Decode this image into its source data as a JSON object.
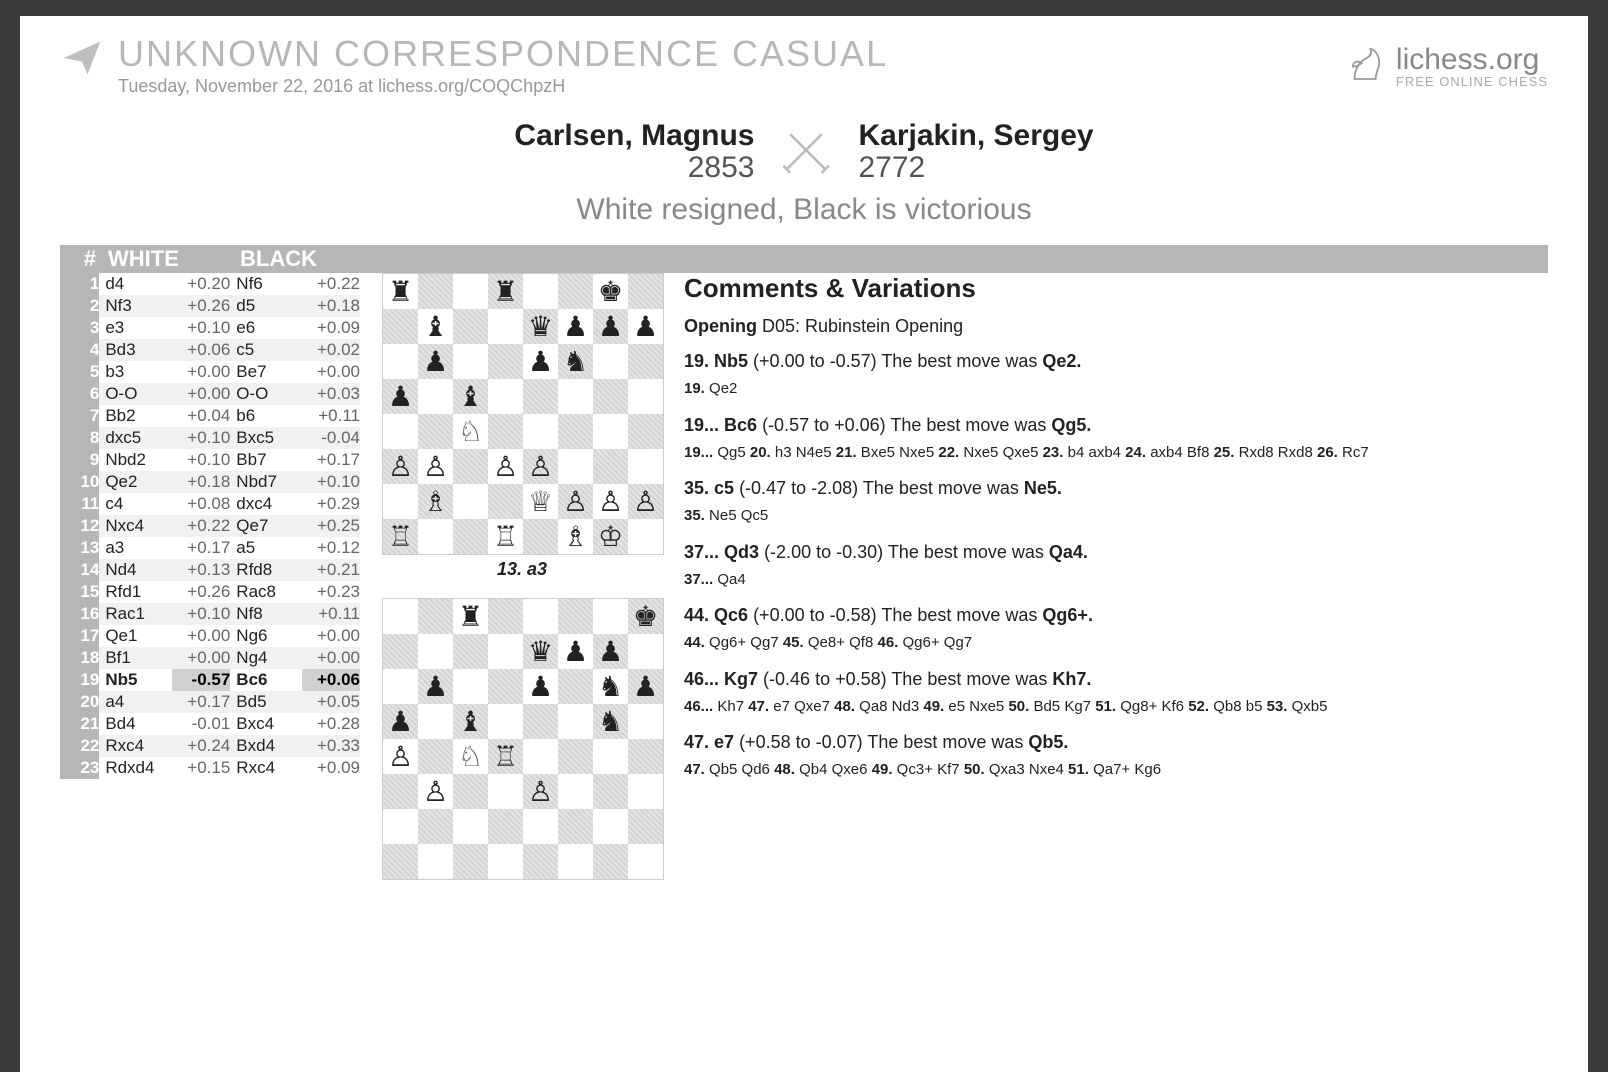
{
  "header": {
    "title": "UNKNOWN   CORRESPONDENCE   CASUAL",
    "subtitle": "Tuesday, November 22, 2016 at lichess.org/COQChpzH",
    "site_name": "lichess.org",
    "site_tag": "FREE ONLINE CHESS"
  },
  "matchup": {
    "white_name": "Carlsen, Magnus",
    "white_rating": "2853",
    "black_name": "Karjakin, Sergey",
    "black_rating": "2772",
    "result": "White resigned, Black is victorious"
  },
  "table_header": {
    "num": "#",
    "white": "WHITE",
    "black": "BLACK"
  },
  "moves": [
    {
      "n": "1",
      "w": "d4",
      "we": "+0.20",
      "b": "Nf6",
      "be": "+0.22"
    },
    {
      "n": "2",
      "w": "Nf3",
      "we": "+0.26",
      "b": "d5",
      "be": "+0.18"
    },
    {
      "n": "3",
      "w": "e3",
      "we": "+0.10",
      "b": "e6",
      "be": "+0.09"
    },
    {
      "n": "4",
      "w": "Bd3",
      "we": "+0.06",
      "b": "c5",
      "be": "+0.02"
    },
    {
      "n": "5",
      "w": "b3",
      "we": "+0.00",
      "b": "Be7",
      "be": "+0.00"
    },
    {
      "n": "6",
      "w": "O-O",
      "we": "+0.00",
      "b": "O-O",
      "be": "+0.03"
    },
    {
      "n": "7",
      "w": "Bb2",
      "we": "+0.04",
      "b": "b6",
      "be": "+0.11"
    },
    {
      "n": "8",
      "w": "dxc5",
      "we": "+0.10",
      "b": "Bxc5",
      "be": "-0.04"
    },
    {
      "n": "9",
      "w": "Nbd2",
      "we": "+0.10",
      "b": "Bb7",
      "be": "+0.17"
    },
    {
      "n": "10",
      "w": "Qe2",
      "we": "+0.18",
      "b": "Nbd7",
      "be": "+0.10"
    },
    {
      "n": "11",
      "w": "c4",
      "we": "+0.08",
      "b": "dxc4",
      "be": "+0.29"
    },
    {
      "n": "12",
      "w": "Nxc4",
      "we": "+0.22",
      "b": "Qe7",
      "be": "+0.25"
    },
    {
      "n": "13",
      "w": "a3",
      "we": "+0.17",
      "b": "a5",
      "be": "+0.12"
    },
    {
      "n": "14",
      "w": "Nd4",
      "we": "+0.13",
      "b": "Rfd8",
      "be": "+0.21"
    },
    {
      "n": "15",
      "w": "Rfd1",
      "we": "+0.26",
      "b": "Rac8",
      "be": "+0.23"
    },
    {
      "n": "16",
      "w": "Rac1",
      "we": "+0.10",
      "b": "Nf8",
      "be": "+0.11"
    },
    {
      "n": "17",
      "w": "Qe1",
      "we": "+0.00",
      "b": "Ng6",
      "be": "+0.00"
    },
    {
      "n": "18",
      "w": "Bf1",
      "we": "+0.00",
      "b": "Ng4",
      "be": "+0.00"
    },
    {
      "n": "19",
      "w": "Nb5",
      "we": "-0.57",
      "b": "Bc6",
      "be": "+0.06",
      "hlw": true,
      "hlb": true
    },
    {
      "n": "20",
      "w": "a4",
      "we": "+0.17",
      "b": "Bd5",
      "be": "+0.05"
    },
    {
      "n": "21",
      "w": "Bd4",
      "we": "-0.01",
      "b": "Bxc4",
      "be": "+0.28"
    },
    {
      "n": "22",
      "w": "Rxc4",
      "we": "+0.24",
      "b": "Bxd4",
      "be": "+0.33"
    },
    {
      "n": "23",
      "w": "Rdxd4",
      "we": "+0.15",
      "b": "Rxc4",
      "be": "+0.09"
    }
  ],
  "board1": {
    "caption": "13. a3",
    "fen_rows": [
      "r··r··k·",
      "·b··qppp",
      "·p··pn··",
      "p·b·····",
      "··N·····",
      "PP·PP···",
      "·B··QPPP",
      "R··R·BK·"
    ]
  },
  "board2": {
    "caption": "",
    "fen_rows_partial": [
      "··r····k",
      "····qpp·",
      "·p··p·np",
      "p·b···n·",
      "P·NR····",
      "·P··P···",
      "········",
      "········"
    ]
  },
  "comments": {
    "header": "Comments & Variations",
    "opening_label": "Opening",
    "opening_text": "D05: Rubinstein Opening",
    "items": [
      {
        "mv": "19. Nb5",
        "eval": "(+0.00 to -0.57)",
        "best_label": "The best move was",
        "best": "Qe2.",
        "var": [
          {
            "n": "19.",
            "t": "Qe2"
          }
        ]
      },
      {
        "mv": "19... Bc6",
        "eval": "(-0.57 to +0.06)",
        "best_label": "The best move was",
        "best": "Qg5.",
        "var": [
          {
            "n": "19...",
            "t": "Qg5"
          },
          {
            "n": "20.",
            "t": "h3 N4e5"
          },
          {
            "n": "21.",
            "t": "Bxe5 Nxe5"
          },
          {
            "n": "22.",
            "t": "Nxe5 Qxe5"
          },
          {
            "n": "23.",
            "t": "b4 axb4"
          },
          {
            "n": "24.",
            "t": "axb4 Bf8"
          },
          {
            "n": "25.",
            "t": "Rxd8 Rxd8"
          },
          {
            "n": "26.",
            "t": "Rc7"
          }
        ]
      },
      {
        "mv": "35. c5",
        "eval": "(-0.47 to -2.08)",
        "best_label": "The best move was",
        "best": "Ne5.",
        "var": [
          {
            "n": "35.",
            "t": "Ne5 Qc5"
          }
        ]
      },
      {
        "mv": "37... Qd3",
        "eval": "(-2.00 to -0.30)",
        "best_label": "The best move was",
        "best": "Qa4.",
        "var": [
          {
            "n": "37...",
            "t": "Qa4"
          }
        ]
      },
      {
        "mv": "44. Qc6",
        "eval": "(+0.00 to -0.58)",
        "best_label": "The best move was",
        "best": "Qg6+.",
        "var": [
          {
            "n": "44.",
            "t": "Qg6+ Qg7"
          },
          {
            "n": "45.",
            "t": "Qe8+ Qf8"
          },
          {
            "n": "46.",
            "t": "Qg6+ Qg7"
          }
        ]
      },
      {
        "mv": "46... Kg7",
        "eval": "(-0.46 to +0.58)",
        "best_label": "The best move was",
        "best": "Kh7.",
        "var": [
          {
            "n": "46...",
            "t": "Kh7"
          },
          {
            "n": "47.",
            "t": "e7 Qxe7"
          },
          {
            "n": "48.",
            "t": "Qa8 Nd3"
          },
          {
            "n": "49.",
            "t": "e5 Nxe5"
          },
          {
            "n": "50.",
            "t": "Bd5 Kg7"
          },
          {
            "n": "51.",
            "t": "Qg8+ Kf6"
          },
          {
            "n": "52.",
            "t": "Qb8 b5"
          },
          {
            "n": "53.",
            "t": "Qxb5"
          }
        ]
      },
      {
        "mv": "47. e7",
        "eval": "(+0.58 to -0.07)",
        "best_label": "The best move was",
        "best": "Qb5.",
        "var": [
          {
            "n": "47.",
            "t": "Qb5 Qd6"
          },
          {
            "n": "48.",
            "t": "Qb4 Qxe6"
          },
          {
            "n": "49.",
            "t": "Qc3+ Kf7"
          },
          {
            "n": "50.",
            "t": "Qxa3 Nxe4"
          },
          {
            "n": "51.",
            "t": "Qa7+ Kg6"
          }
        ]
      }
    ]
  },
  "piece_map": {
    "K": "♔",
    "Q": "♕",
    "R": "♖",
    "B": "♗",
    "N": "♘",
    "P": "♙",
    "k": "♚",
    "q": "♛",
    "r": "♜",
    "b": "♝",
    "n": "♞",
    "p": "♟",
    "·": ""
  }
}
